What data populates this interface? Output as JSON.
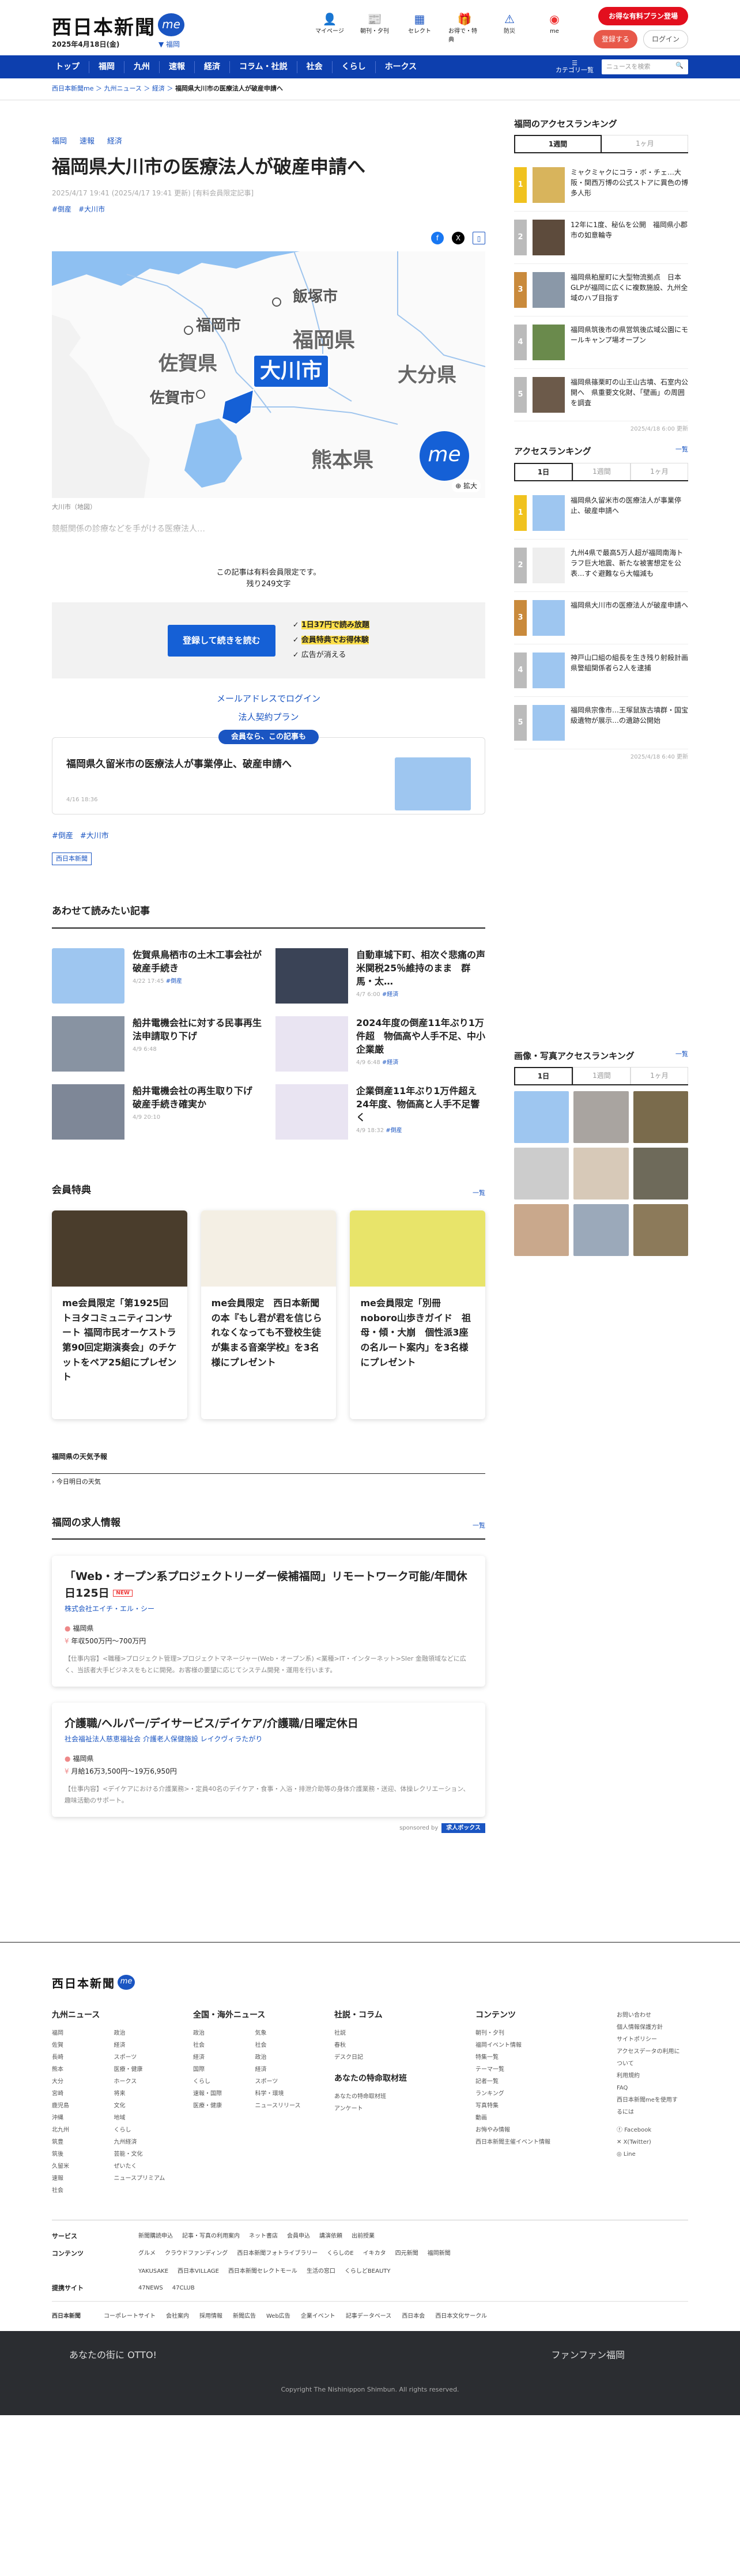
{
  "header": {
    "logo": "西日本新聞",
    "me": "me",
    "date": "2025年4月18日(金)",
    "region": "福岡",
    "icons": [
      {
        "name": "mypage-icon",
        "label": "マイページ"
      },
      {
        "name": "newspaper-icon",
        "label": "朝刊・夕刊"
      },
      {
        "name": "select-icon",
        "label": "セレクト"
      },
      {
        "name": "gift-icon",
        "label": "お得で・特典"
      },
      {
        "name": "disaster-icon",
        "label": "防災"
      },
      {
        "name": "app-icon",
        "label": "me"
      }
    ],
    "promo": "お得な有料プラン登場",
    "register": "登録する",
    "login": "ログイン"
  },
  "nav": {
    "items": [
      "トップ",
      "福岡",
      "九州",
      "速報",
      "経済",
      "コラム・社説",
      "社会",
      "くらし",
      "ホークス"
    ],
    "category": "カテゴリ一覧",
    "search_placeholder": "ニュースを検索"
  },
  "breadcrumb": {
    "items": [
      "西日本新聞me",
      "九州ニュース",
      "経済"
    ],
    "current": "福岡県大川市の医療法人が破産申請へ"
  },
  "article": {
    "tags": [
      "福岡",
      "速報",
      "経済"
    ],
    "title": "福岡県大川市の医療法人が破産申請へ",
    "meta": "2025/4/17 19:41 (2025/4/17 19:41 更新) [有料会員限定記事]",
    "keywords": [
      "#倒産",
      "#大川市"
    ],
    "map_caption": "大川市（地図）",
    "map_labels": [
      "福岡市",
      "飯塚市",
      "福岡県",
      "佐賀県",
      "佐賀市",
      "大川市",
      "大分県",
      "熊本県"
    ],
    "map_badge": "me",
    "map_expand": "拡大",
    "lead": "競艇関係の診療などを手がける医療法人…",
    "paywall_text": "この記事は有料会員限定です。",
    "remaining": "残り249文字",
    "cta": "登録して続きを読む",
    "features": [
      "1日37円で読み放題",
      "会員特典でお得体験",
      "広告が消える"
    ],
    "links": [
      "メールアドレスでログイン",
      "法人契約プラン"
    ],
    "member_badge": "会員なら、この記事も",
    "related_title": "福岡県久留米市の医療法人が事業停止、破産申請へ",
    "related_date": "4/16 18:36",
    "keywords2": [
      "#倒産",
      "#大川市"
    ],
    "publisher": "西日本新聞"
  },
  "also": {
    "title": "あわせて読みたい記事",
    "items": [
      {
        "title": "佐賀県鳥栖市の土木工事会社が破産手続き",
        "date": "4/22 17:45",
        "tag": "#倒産"
      },
      {
        "title": "自動車城下町、相次ぐ悲痛の声　米関税25％維持のまま　群馬・太…",
        "date": "4/7 6:00",
        "tag": "#経済"
      },
      {
        "title": "船井電機会社に対する民事再生法申請取り下げ",
        "date": "4/9 6:48",
        "tag": ""
      },
      {
        "title": "2024年度の倒産11年ぶり1万件超　物価高や人手不足、中小企業厳",
        "date": "4/9 6:48",
        "tag": "#経済"
      },
      {
        "title": "船井電機会社の再生取り下げ　破産手続き確実か",
        "date": "4/9 20:10",
        "tag": ""
      },
      {
        "title": "企業倒産11年ぶり1万件超え　24年度、物価高と人手不足響く",
        "date": "4/9 18:32",
        "tag": "#倒産"
      }
    ]
  },
  "benefits": {
    "title": "会員特典",
    "more": "一覧",
    "items": [
      "me会員限定「第1925回トヨタコミュニティコンサート 福岡市民オーケストラ第90回定期演奏会」のチケットをペア25組にプレゼント",
      "me会員限定　西日本新聞の本『もし君が君を信じられなくなっても不登校生徒が集まる音楽学校』を3名様にプレゼント",
      "me会員限定「別冊noboro山歩きガイド　祖母・傾・大崩　個性派3座の名ルート案内」を3名様にプレゼント"
    ]
  },
  "weather": {
    "title": "福岡県の天気予報",
    "link": "今日明日の天気"
  },
  "jobs": {
    "title": "福岡の求人情報",
    "more": "一覧",
    "items": [
      {
        "title": "「Web・オープン系プロジェクトリーダー候補福岡」リモートワーク可能/年間休日125日",
        "badge": "NEW",
        "company": "株式会社エイチ・エル・シー",
        "place": "福岡県",
        "salary": "年収500万円〜700万円",
        "desc": "【仕事内容】<職種>プロジェクト管理>プロジェクトマネージャー(Web・オープン系) <業種>IT・インターネット>SIer 金融領域などに広く、当該者大手ビジネスをもとに開発。お客様の要望に応じてシステム開発・運用を行います。"
      },
      {
        "title": "介護職/ヘルパー/デイサービス/デイケア/介護職/日曜定休日",
        "badge": "",
        "company": "社会福祉法人慈恵福祉会 介護老人保健施設 レイクヴィラたがり",
        "place": "福岡県",
        "salary": "月給16万3,500円〜19万6,950円",
        "desc": "【仕事内容】<デイケアにおける介護業務>・定員40名のデイケア・食事・入浴・排泄介助等の身体介護業務・送迎、体操レクリエーション、趣味活動のサポート。"
      }
    ],
    "sponsor": "sponsored by",
    "sponsor_brand": "求人ボックス"
  },
  "sidebar": {
    "ranking1_title": "福岡のアクセスランキング",
    "tabs1": [
      "1週間",
      "1ヶ月"
    ],
    "ranking1": [
      "ミャクミャクにコラ・ボ・チェ…大阪・関西万博の公式ストアに異色の博多人形",
      "12年に1度、秘仏を公開　福岡県小郡市の如意輪寺",
      "福岡県粕屋町に大型物流拠点　日本GLPが福岡に広くに複数施設、九州全域のハブ目指す",
      "福岡県筑後市の県営筑後広域公園にモールキャンプ場オープン",
      "福岡県篠栗町の山王山古墳、石室内公開へ　県重要文化財、「壁画」の周囲を調査"
    ],
    "updated1": "2025/4/18 6:00 更新",
    "ranking2_title": "アクセスランキング",
    "ranking2_more": "一覧",
    "tabs2": [
      "1日",
      "1週間",
      "1ヶ月"
    ],
    "ranking2": [
      "福岡県久留米市の医療法人が事業停止、破産申請へ",
      "九州4県で最高5万人超が福岡南海トラフ巨大地震、新たな被害想定を公表…すぐ避難なら大幅減も",
      "福岡県大川市の医療法人が破産申請へ",
      "神戸山口組の組長を生き残り射殺計画　県警組関係者ら2人を逮捕",
      "福岡県宗像市…王塚鼠族古墳群・国宝級遺物が展示…の遺跡公開始"
    ],
    "updated2": "2025/4/18 6:40 更新",
    "photo_title": "画像・写真アクセスランキング",
    "photo_more": "一覧",
    "tabs3": [
      "1日",
      "1週間",
      "1ヶ月"
    ]
  },
  "footer": {
    "logo": "西日本新聞",
    "cols": [
      {
        "title": "九州ニュース",
        "links": [
          "福岡",
          "佐賀",
          "長崎",
          "熊本",
          "大分",
          "宮崎",
          "鹿児島",
          "沖縄",
          "北九州",
          "筑豊",
          "筑後",
          "久留米",
          "速報",
          "社会",
          "政治",
          "経済",
          "スポーツ",
          "医療・健康",
          "ホークス",
          "将来",
          "文化",
          "地域",
          "くらし",
          "九州経済",
          "芸能・文化",
          "ぜいたく",
          "ニュースプリミアム"
        ]
      },
      {
        "title": "全国・海外ニュース",
        "links": [
          "政治",
          "社会",
          "経済",
          "国際",
          "くらし",
          "速報・国際",
          "医療・健康",
          "気象",
          "社会",
          "政治",
          "経済",
          "スポーツ",
          "科学・環境",
          "ニュースリリース"
        ]
      },
      {
        "title": "社説・コラム",
        "links": [
          "社説",
          "春秋",
          "デスク日記"
        ]
      },
      {
        "title": "あなたの特命取材班",
        "links": [
          "あなたの特命取材班",
          "アンケート"
        ]
      },
      {
        "title": "コンテンツ",
        "links": [
          "朝刊・夕刊",
          "福岡イベント情報",
          "特集一覧",
          "テーマ一覧",
          "記者一覧",
          "ランキング",
          "写真特集",
          "動画",
          "お悔やみ情報",
          "西日本新聞主催イベント情報"
        ]
      }
    ],
    "side_links": [
      "お問い合わせ",
      "個人情報保護方針",
      "サイトポリシー",
      "アクセスデータの利用について",
      "利用規約",
      "FAQ",
      "西日本新聞meを使用するには"
    ],
    "social": [
      "Facebook",
      "X(Twitter)",
      "Line"
    ],
    "rows": [
      {
        "head": "サービス",
        "items": [
          "新聞購読申込",
          "記事・写真の利用案内",
          "ネット書店",
          "会員申込",
          "講演依頼",
          "出前授業"
        ]
      },
      {
        "head": "コンテンツ",
        "items": [
          "グルメ",
          "クラウドファンディング",
          "西日本新聞フォトライブラリー",
          "くらしのE",
          "イキカタ",
          "四元新聞",
          "福岡新聞"
        ]
      },
      {
        "head": "",
        "items": [
          "YAKUSAKE",
          "西日本VILLAGE",
          "西日本新聞セレクトモール",
          "生活の窓口",
          "くらしどBEAUTY"
        ]
      },
      {
        "head": "提携サイト",
        "items": [
          "47NEWS",
          "47CLUB"
        ]
      }
    ],
    "corp": [
      "コーポレートサイト",
      "会社案内",
      "採用情報",
      "新聞広告",
      "Web広告",
      "企業イベント",
      "記事データベース",
      "西日本会",
      "西日本文化サークル"
    ],
    "dark_left": "あなたの街に OTTO!",
    "dark_right": "ファンファン福岡",
    "copyright": "Copyright The Nishinippon Shimbun. All rights reserved."
  }
}
